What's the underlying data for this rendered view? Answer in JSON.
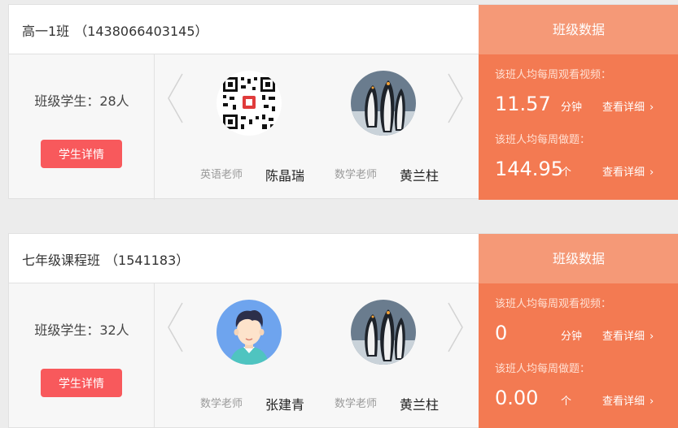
{
  "classes": [
    {
      "name": "高一1班",
      "code": "（1438066403145）",
      "student_count": "班级学生：28人",
      "detail_button": "学生详情",
      "teachers": [
        {
          "role": "英语老师",
          "name": "陈晶瑞",
          "avatar": "qr-code-icon"
        },
        {
          "role": "数学老师",
          "name": "黄兰柱",
          "avatar": "penguin-icon"
        }
      ],
      "data_title": "班级数据",
      "video_label": "该班人均每周观看视频：",
      "video_value": "11.57",
      "video_unit": "分钟",
      "video_link": "查看详细",
      "problem_label": "该班人均每周做题：",
      "problem_value": "144.95",
      "problem_unit": "个",
      "problem_link": "查看详细"
    },
    {
      "name": "七年级课程班",
      "code": "（1541183）",
      "student_count": "班级学生：32人",
      "detail_button": "学生详情",
      "teachers": [
        {
          "role": "数学老师",
          "name": "张建青",
          "avatar": "cartoon-boy-icon"
        },
        {
          "role": "数学老师",
          "name": "黄兰柱",
          "avatar": "penguin-icon"
        }
      ],
      "data_title": "班级数据",
      "video_label": "该班人均每周观看视频：",
      "video_value": "0",
      "video_unit": "分钟",
      "video_link": "查看详细",
      "problem_label": "该班人均每周做题：",
      "problem_value": "0.00",
      "problem_unit": "个",
      "problem_link": "查看详细"
    }
  ],
  "chevron_right": "›",
  "colors": {
    "accent": "#f37a52",
    "accent_light": "#f59977",
    "button": "#f8595c"
  }
}
